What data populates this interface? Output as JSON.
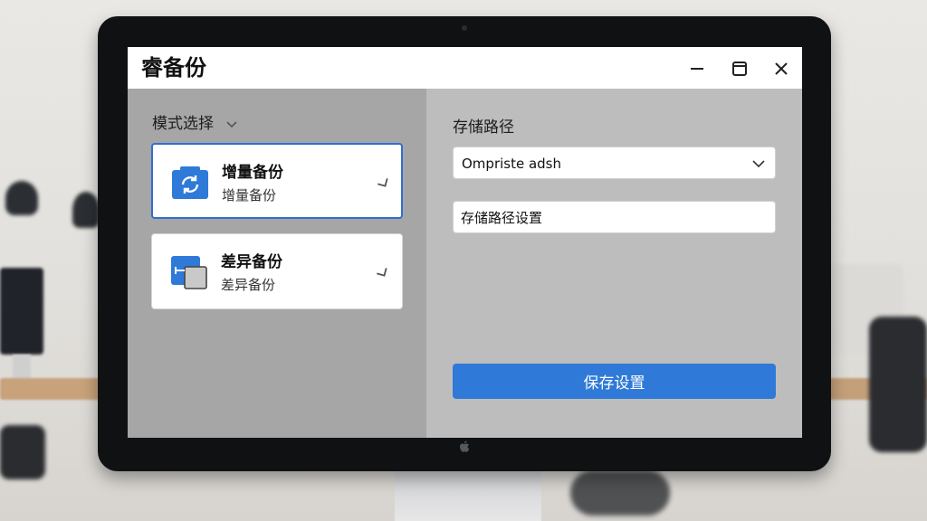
{
  "window": {
    "title": "睿备份"
  },
  "left": {
    "mode_label": "模式选择",
    "cards": [
      {
        "title": "增量备份",
        "subtitle": "增量备份",
        "icon": "refresh-folder-icon",
        "selected": true
      },
      {
        "title": "差异备份",
        "subtitle": "差异备份",
        "icon": "diff-copy-icon",
        "selected": false
      }
    ]
  },
  "right": {
    "path_label": "存储路径",
    "path_select_value": "Ompriste adsh",
    "settings_input_value": "存储路径设置",
    "save_button": "保存设置"
  },
  "colors": {
    "accent": "#2f7ad8",
    "left_pane": "#a6a6a6",
    "right_pane": "#bdbdbd"
  }
}
